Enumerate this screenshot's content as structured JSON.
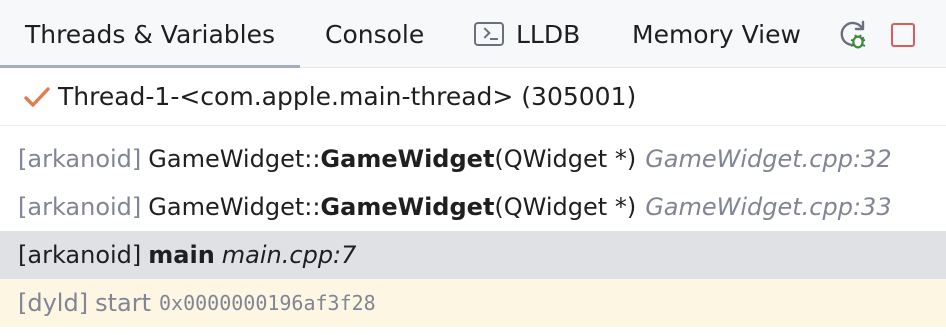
{
  "tabs": {
    "threads_variables": "Threads & Variables",
    "console": "Console",
    "lldb": "LLDB",
    "memory_view": "Memory View"
  },
  "toolbar": {
    "rerun_icon": "rerun-debug-icon",
    "stop_icon": "stop-icon",
    "stop_color": "#db5c5c",
    "rerun_color": "#3e8a3e"
  },
  "thread": {
    "label": "Thread-1-<com.apple.main-thread> (305001)",
    "status_icon": "checkmark-icon",
    "status_color": "#e07b53"
  },
  "frames": [
    {
      "module": "[arkanoid]",
      "scope": "GameWidget::",
      "function": "GameWidget",
      "args": "(QWidget *)",
      "location": "GameWidget.cpp:32"
    },
    {
      "module": "[arkanoid]",
      "scope": "GameWidget::",
      "function": "GameWidget",
      "args": "(QWidget *)",
      "location": "GameWidget.cpp:33"
    },
    {
      "module": "[arkanoid]",
      "function": "main",
      "location": "main.cpp:7",
      "selected": true
    },
    {
      "module": "[dyld]",
      "function": "start",
      "address": "0x0000000196af3f28",
      "library": true
    }
  ]
}
